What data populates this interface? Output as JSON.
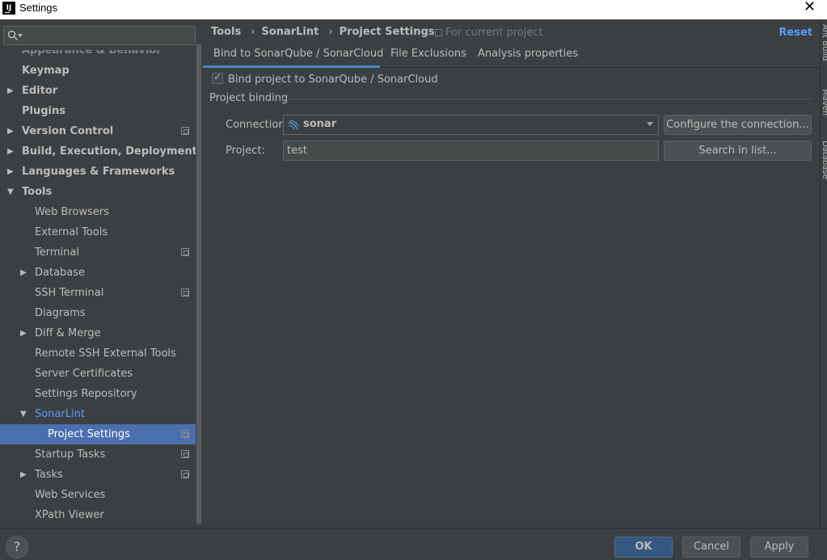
{
  "window": {
    "title": "Settings",
    "app_icon": "IJ",
    "close_glyph": "✕"
  },
  "search": {
    "placeholder": ""
  },
  "sidebar": {
    "partial_top": "Appearance & Behavior",
    "items": [
      {
        "label": "Keymap"
      },
      {
        "label": "Editor"
      },
      {
        "label": "Plugins"
      },
      {
        "label": "Version Control"
      },
      {
        "label": "Build, Execution, Deployment"
      },
      {
        "label": "Languages & Frameworks"
      },
      {
        "label": "Tools"
      },
      {
        "label": "Web Browsers"
      },
      {
        "label": "External Tools"
      },
      {
        "label": "Terminal"
      },
      {
        "label": "Database"
      },
      {
        "label": "SSH Terminal"
      },
      {
        "label": "Diagrams"
      },
      {
        "label": "Diff & Merge"
      },
      {
        "label": "Remote SSH External Tools"
      },
      {
        "label": "Server Certificates"
      },
      {
        "label": "Settings Repository"
      },
      {
        "label": "SonarLint"
      },
      {
        "label": "Project Settings"
      },
      {
        "label": "Startup Tasks"
      },
      {
        "label": "Tasks"
      },
      {
        "label": "Web Services"
      },
      {
        "label": "XPath Viewer"
      }
    ]
  },
  "header": {
    "breadcrumb": [
      "Tools",
      "SonarLint",
      "Project Settings"
    ],
    "breadcrumb_sep": "›",
    "for_current_project": "For current project",
    "reset": "Reset"
  },
  "tabs": [
    {
      "label": "Bind to SonarQube / SonarCloud",
      "active": true
    },
    {
      "label": "File Exclusions",
      "active": false
    },
    {
      "label": "Analysis properties",
      "active": false
    }
  ],
  "form": {
    "bind_checkbox_label": "Bind project to SonarQube / SonarCloud",
    "bind_checked": true,
    "section_title": "Project binding",
    "connection_label": "Connection:",
    "connection_value": "sonar",
    "configure_button": "Configure the connection...",
    "project_label": "Project:",
    "project_value": "test",
    "search_button": "Search in list..."
  },
  "right_strip": {
    "labels": [
      "Ant Build",
      "Maven",
      "Database"
    ]
  },
  "footer": {
    "help": "?",
    "ok": "OK",
    "cancel": "Cancel",
    "apply": "Apply"
  },
  "colors": {
    "background": "#3c3f41",
    "selection": "#4b6eaf",
    "link": "#589df6",
    "ok_button": "#365880"
  }
}
